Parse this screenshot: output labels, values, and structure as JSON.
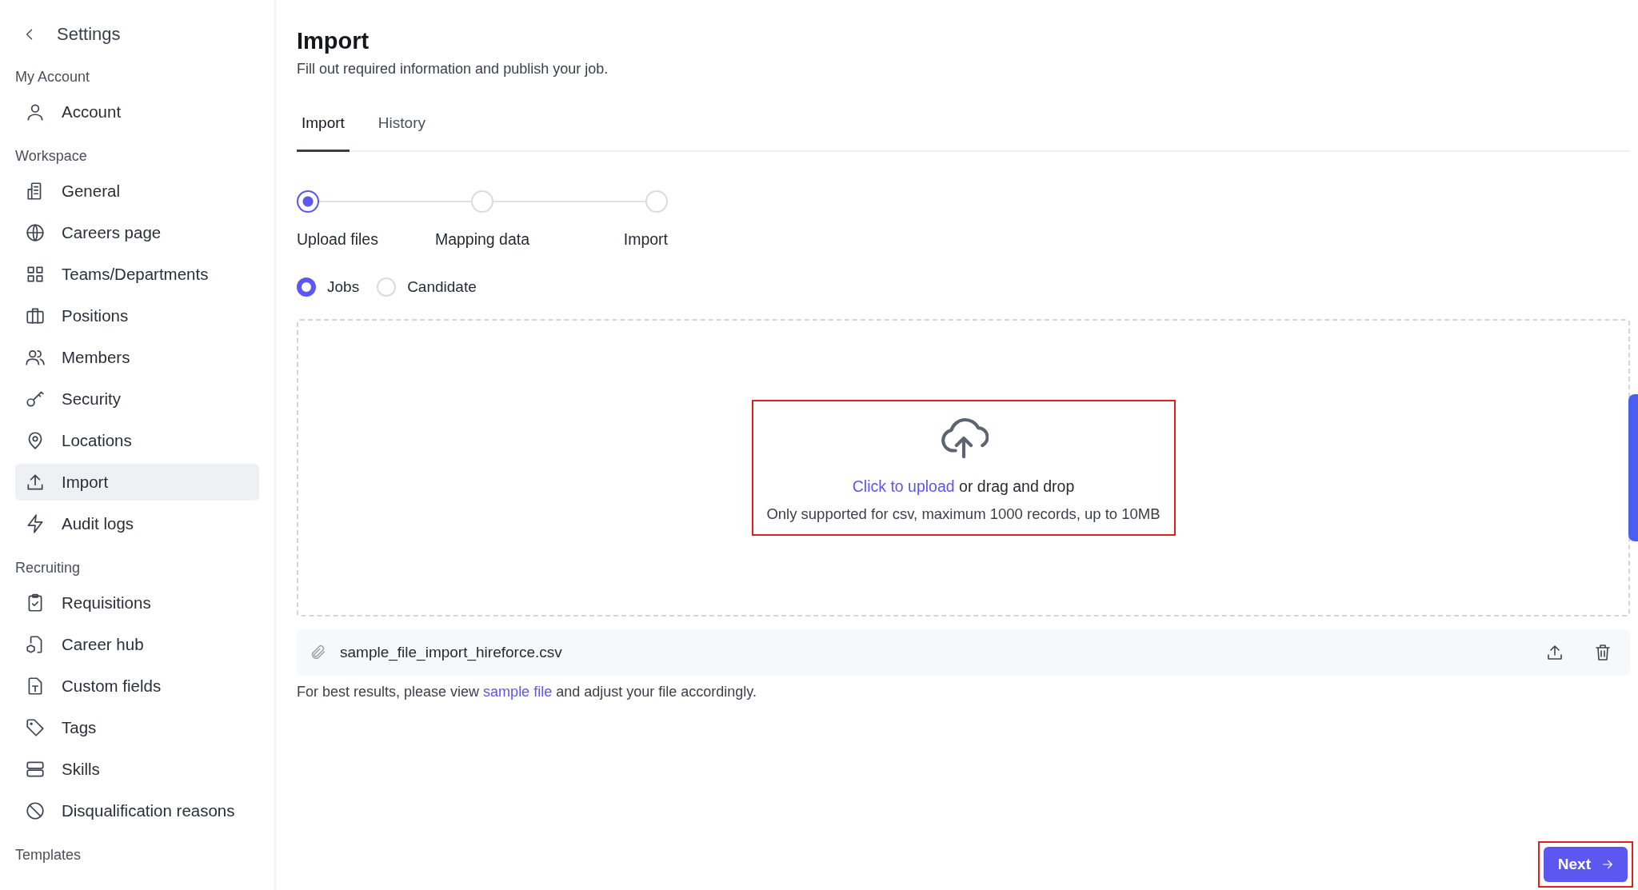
{
  "sidebar": {
    "back": "Settings",
    "sections": [
      {
        "title": "My Account",
        "items": [
          {
            "label": "Account",
            "selected": false
          }
        ]
      },
      {
        "title": "Workspace",
        "items": [
          {
            "label": "General",
            "selected": false
          },
          {
            "label": "Careers page",
            "selected": false
          },
          {
            "label": "Teams/Departments",
            "selected": false
          },
          {
            "label": "Positions",
            "selected": false
          },
          {
            "label": "Members",
            "selected": false
          },
          {
            "label": "Security",
            "selected": false
          },
          {
            "label": "Locations",
            "selected": false
          },
          {
            "label": "Import",
            "selected": true
          },
          {
            "label": "Audit logs",
            "selected": false
          }
        ]
      },
      {
        "title": "Recruiting",
        "items": [
          {
            "label": "Requisitions",
            "selected": false
          },
          {
            "label": "Career hub",
            "selected": false
          },
          {
            "label": "Custom fields",
            "selected": false
          },
          {
            "label": "Tags",
            "selected": false
          },
          {
            "label": "Skills",
            "selected": false
          },
          {
            "label": "Disqualification reasons",
            "selected": false
          }
        ]
      },
      {
        "title": "Templates"
      }
    ]
  },
  "page": {
    "title": "Import",
    "subtitle": "Fill out required information and publish your job."
  },
  "tabs": [
    {
      "label": "Import",
      "selected": true
    },
    {
      "label": "History",
      "selected": false
    }
  ],
  "steps": [
    {
      "label": "Upload files",
      "selected": true
    },
    {
      "label": "Mapping data",
      "selected": false
    },
    {
      "label": "Import",
      "selected": false
    }
  ],
  "import_type": [
    {
      "label": "Jobs",
      "selected": true
    },
    {
      "label": "Candidate",
      "selected": false
    }
  ],
  "dropzone": {
    "link": "Click to upload",
    "text": "or drag and drop",
    "hint": "Only supported for csv, maximum 1000 records, up to 10MB",
    "highlighted": true
  },
  "file": {
    "name": "sample_file_import_hireforce.csv"
  },
  "help": {
    "before": "For best results, please view",
    "link": "sample file",
    "after": "and adjust your file accordingly."
  },
  "next_button": {
    "label": "Next",
    "highlighted": true
  }
}
